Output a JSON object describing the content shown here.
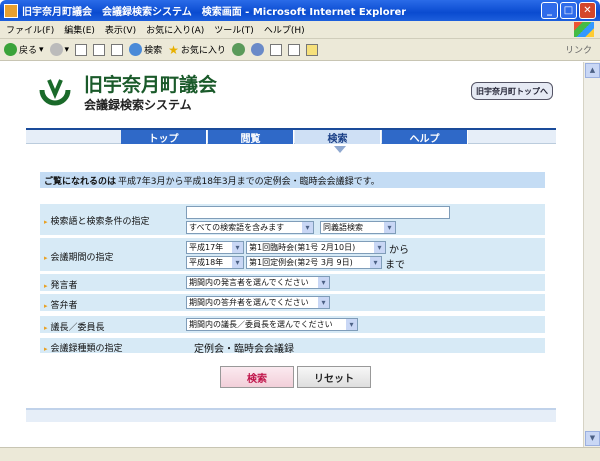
{
  "window": {
    "title": "旧宇奈月町議会　会議録検索システム　検索画面 - Microsoft Internet Explorer",
    "min": "_",
    "max": "□",
    "close": "✕"
  },
  "menu": [
    "ファイル(F)",
    "編集(E)",
    "表示(V)",
    "お気に入り(A)",
    "ツール(T)",
    "ヘルプ(H)"
  ],
  "toolbar": {
    "back": "戻る",
    "search": "検索",
    "favorites": "お気に入り",
    "links": "リンク"
  },
  "header": {
    "site_name": "旧宇奈月町議会",
    "sub_name": "会議録検索システム",
    "top_link": "旧宇奈月町トップへ"
  },
  "nav": [
    "トップ",
    "閲覧",
    "検索",
    "ヘルプ"
  ],
  "notice": {
    "lead": "ご覧になれるのは",
    "rest": "平成7年3月から平成18年3月までの定例会・臨時会会議録です。"
  },
  "form": {
    "keyword": {
      "label": "検索語と検索条件の指定",
      "input_value": "",
      "condition": "すべての検索語を含みます",
      "synonym": "同義語検索"
    },
    "period": {
      "label": "会議期間の指定",
      "from_year": "平成17年",
      "from_session": "第1回臨時会(第1号 2月10日)",
      "from_suffix": "から",
      "to_year": "平成18年",
      "to_session": "第1回定例会(第2号 3月 9日)",
      "to_suffix": "まで"
    },
    "speaker": {
      "label": "発言者",
      "value": "期間内の発言者を選んでください"
    },
    "respondent": {
      "label": "答弁者",
      "value": "期間内の答弁者を選んでください"
    },
    "chair": {
      "label": "議長／委員長",
      "value": "期間内の議長／委員長を選んでください"
    },
    "record_type": {
      "label": "会議録種類の指定",
      "value": "定例会・臨時会会議録"
    }
  },
  "buttons": {
    "search": "検索",
    "reset": "リセット"
  }
}
